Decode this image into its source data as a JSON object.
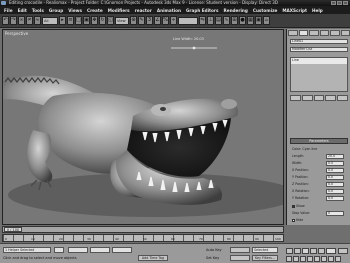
{
  "window": {
    "title": "Editing crocodile - Realismax - Project Folder: C:\\Gnomon Projects - Autodesk 3ds Max 9 - License: Student version - Display: Direct 3D"
  },
  "menu": [
    "File",
    "Edit",
    "Tools",
    "Group",
    "Views",
    "Create",
    "Modifiers",
    "reactor",
    "Animation",
    "Graph Editors",
    "Rendering",
    "Customize",
    "MAXScript",
    "Help"
  ],
  "toolbar": {
    "selection_filter": "All",
    "reference_coord": "View",
    "named_selection": ""
  },
  "viewport": {
    "label": "Perspective",
    "readout": "Line Width: 20.03"
  },
  "command_panel": {
    "object_name": "Line01",
    "modifier_list": "Modifier List",
    "stack_item": "Line",
    "rollout_title": "Parameters",
    "params": [
      {
        "label": "Color: Cyan line",
        "value": ""
      },
      {
        "label": "Length:",
        "value": "20.0"
      },
      {
        "label": "Width:",
        "value": "0.5"
      },
      {
        "label": "X Position:",
        "value": "0.0"
      },
      {
        "label": "Y Position:",
        "value": "0.0"
      },
      {
        "label": "Z Position:",
        "value": "0.0"
      },
      {
        "label": "X Rotation:",
        "value": "0.0"
      },
      {
        "label": "Y Rotation:",
        "value": "0.0"
      }
    ],
    "checkbox_1": "Show",
    "checkbox_2": "Hide",
    "stop_label": "Stop Value:",
    "stop_value": "0"
  },
  "timeline": {
    "frame_label": "0 / 100",
    "ticks": [
      "0",
      "10",
      "20",
      "30",
      "40",
      "50",
      "60",
      "70",
      "80",
      "90",
      "100"
    ]
  },
  "status": {
    "selection": "1 Helper Selected",
    "prompt": "Click and drag to select and move objects",
    "add_time_tag": "Add Time Tag",
    "auto_key": "Auto Key",
    "set_key": "Set Key",
    "key_mode": "Selected",
    "key_filters": "Key Filters..."
  }
}
